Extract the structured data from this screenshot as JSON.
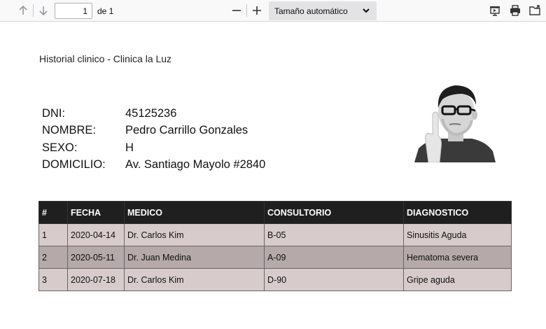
{
  "toolbar": {
    "page_number": "1",
    "page_of": "de 1",
    "zoom_value": "Tamaño automático",
    "icons": [
      "arrow-up-icon",
      "arrow-down-icon",
      "zoom-out-icon",
      "zoom-in-icon",
      "presentation-icon",
      "print-icon",
      "open-file-icon"
    ]
  },
  "document": {
    "title": "Historial clinico - Clinica la Luz",
    "fields": [
      {
        "label": "DNI:",
        "value": "45125236"
      },
      {
        "label": "NOMBRE:",
        "value": "Pedro Carrillo Gonzales"
      },
      {
        "label": "SEXO:",
        "value": "H"
      },
      {
        "label": "DOMICILIO:",
        "value": "Av. Santiago Mayolo #2840"
      }
    ],
    "table": {
      "headers": [
        "#",
        "FECHA",
        "MEDICO",
        "CONSULTORIO",
        "DIAGNOSTICO"
      ],
      "rows": [
        [
          "1",
          "2020-04-14",
          "Dr. Carlos Kim",
          "B-05",
          "Sinusitis Aguda"
        ],
        [
          "2",
          "2020-05-11",
          "Dr. Juan Medina",
          "A-09",
          "Hematoma severa"
        ],
        [
          "3",
          "2020-07-18",
          "Dr. Carlos Kim",
          "D-90",
          "Gripe aguda"
        ]
      ]
    }
  },
  "colors": {
    "header_bg": "#1f1f1f",
    "row_light": "#d8cbcb",
    "row_dark": "#b5a9a9"
  }
}
